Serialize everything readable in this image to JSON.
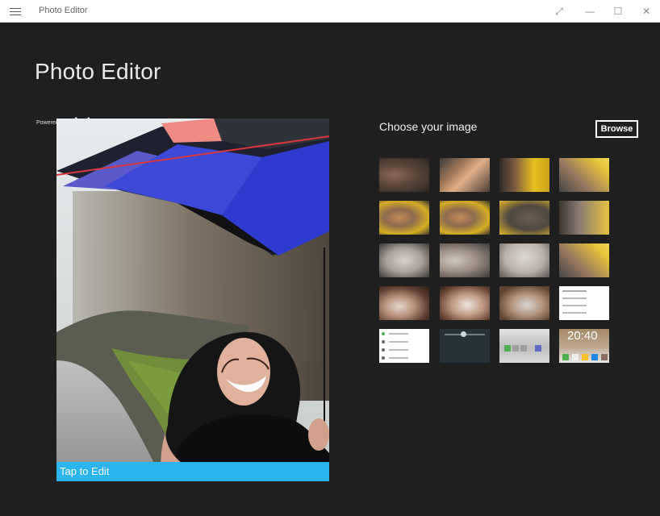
{
  "window": {
    "title": "Photo Editor",
    "controls": {
      "expand": "⤢",
      "minimize": "—",
      "maximize": "☐",
      "close": "✕"
    }
  },
  "app": {
    "title": "Photo Editor",
    "powered_by": "Powered by",
    "brand": "Aviary"
  },
  "preview": {
    "tap_label": "Tap to Edit"
  },
  "chooser": {
    "heading": "Choose your image",
    "browse_label": "Browse",
    "clock_text": "20:40"
  },
  "colors": {
    "background": "#1f1f1f",
    "accent": "#2bb4f0",
    "titlebar": "#ffffff"
  },
  "icons": [
    "hamburger-icon",
    "expand-icon",
    "minimize-icon",
    "maximize-icon",
    "close-icon"
  ]
}
